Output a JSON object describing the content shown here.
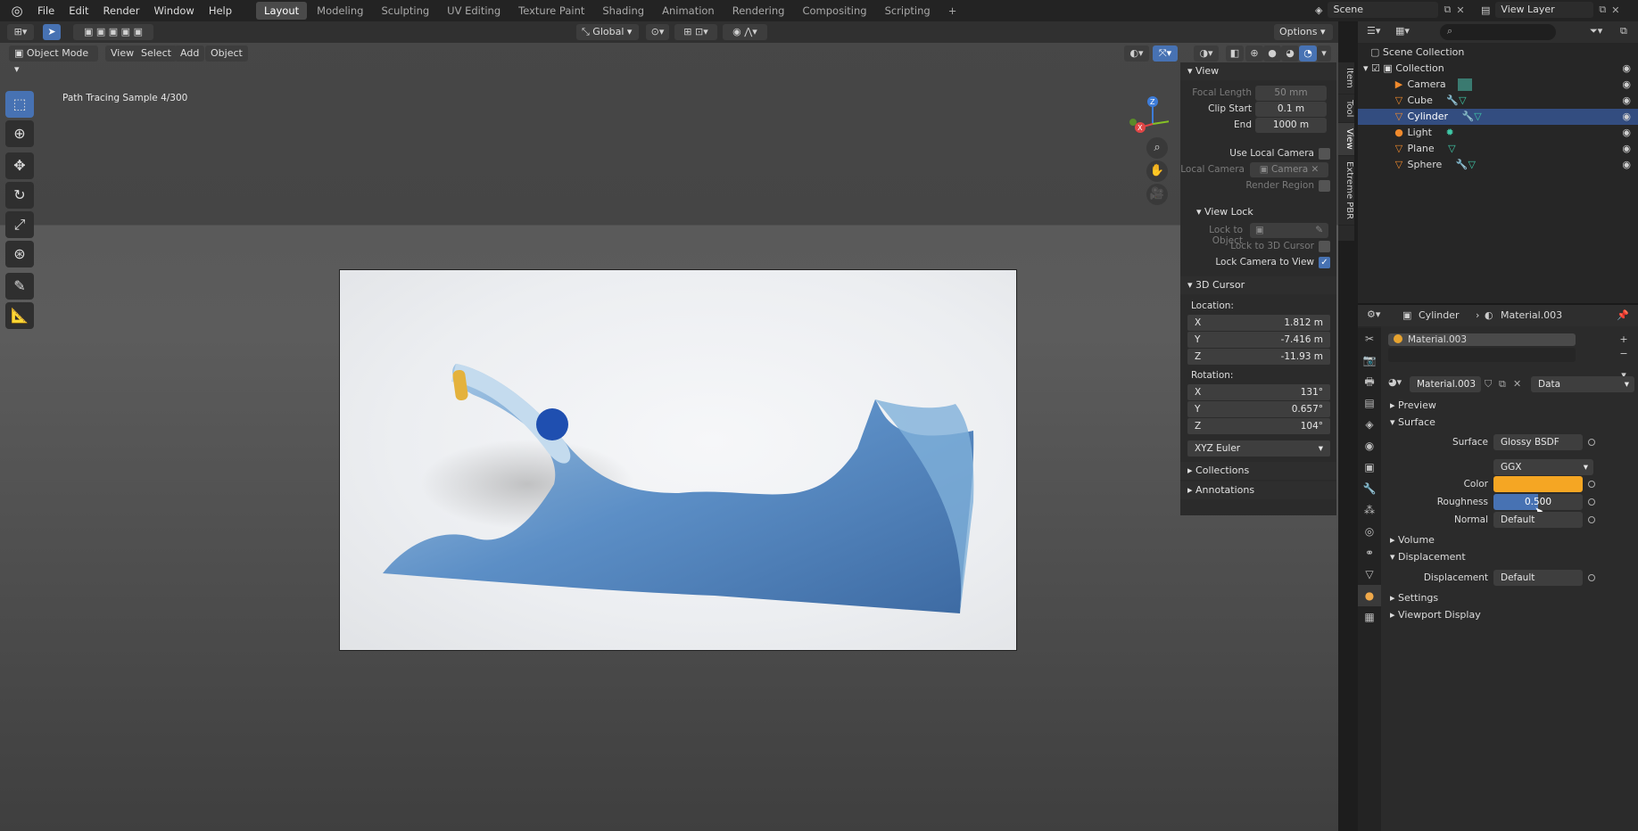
{
  "topbar": {
    "menus": [
      "File",
      "Edit",
      "Render",
      "Window",
      "Help"
    ],
    "workspaces": [
      "Layout",
      "Modeling",
      "Sculpting",
      "UV Editing",
      "Texture Paint",
      "Shading",
      "Animation",
      "Rendering",
      "Compositing",
      "Scripting"
    ],
    "active_workspace": "Layout",
    "add_tab": "+",
    "scene_name": "Scene",
    "view_layer": "View Layer"
  },
  "viewport": {
    "orientation": "Global",
    "options_label": "Options",
    "mode": "Object Mode",
    "menus": [
      "View",
      "Select",
      "Add",
      "Object"
    ],
    "status": "Path Tracing Sample 4/300"
  },
  "npanel": {
    "tabs": [
      "Item",
      "Tool",
      "View",
      "Extreme PBR"
    ],
    "active_tab": "View",
    "view_section": "View",
    "focal_length_label": "Focal Length",
    "focal_length": "50 mm",
    "clip_start_label": "Clip Start",
    "clip_start": "0.1 m",
    "end_label": "End",
    "end": "1000 m",
    "use_local_camera": "Use Local Camera",
    "local_camera_label": "Local Camera",
    "local_camera": "Camera",
    "render_region": "Render Region",
    "view_lock_section": "View Lock",
    "lock_to_object": "Lock to Object",
    "lock_to_3d_cursor": "Lock to 3D Cursor",
    "lock_camera_to_view": "Lock Camera to View",
    "cursor_section": "3D Cursor",
    "location_label": "Location:",
    "location": [
      {
        "axis": "X",
        "value": "1.812 m"
      },
      {
        "axis": "Y",
        "value": "-7.416 m"
      },
      {
        "axis": "Z",
        "value": "-11.93 m"
      }
    ],
    "rotation_label": "Rotation:",
    "rotation": [
      {
        "axis": "X",
        "value": "131°"
      },
      {
        "axis": "Y",
        "value": "0.657°"
      },
      {
        "axis": "Z",
        "value": "104°"
      }
    ],
    "rotation_mode": "XYZ Euler",
    "collections_section": "Collections",
    "annotations_section": "Annotations"
  },
  "outliner": {
    "root": "Scene Collection",
    "collection": "Collection",
    "items": [
      {
        "name": "Camera",
        "selected": false
      },
      {
        "name": "Cube",
        "selected": false
      },
      {
        "name": "Cylinder",
        "selected": true
      },
      {
        "name": "Light",
        "selected": false
      },
      {
        "name": "Plane",
        "selected": false
      },
      {
        "name": "Sphere",
        "selected": false
      }
    ]
  },
  "properties": {
    "object_name": "Cylinder",
    "material_name": "Material.003",
    "slot_name": "Material.003",
    "link_mode": "Data",
    "sections": {
      "preview": "Preview",
      "surface": "Surface",
      "volume": "Volume",
      "displacement": "Displacement",
      "settings": "Settings",
      "viewport_display": "Viewport Display"
    },
    "surface_label": "Surface",
    "surface_shader": "Glossy BSDF",
    "distribution": "GGX",
    "color_label": "Color",
    "color_value": "#f5a623",
    "roughness_label": "Roughness",
    "roughness": "0.500",
    "normal_label": "Normal",
    "normal": "Default",
    "displacement_label": "Displacement",
    "displacement": "Default"
  }
}
